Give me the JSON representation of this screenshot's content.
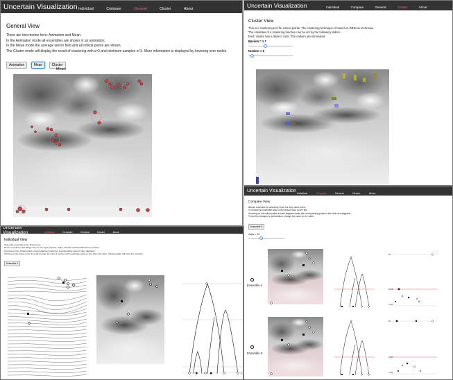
{
  "general": {
    "brand": "Uncertain Visualization",
    "nav": [
      "Individual",
      "Compare",
      "General",
      "Cluster",
      "About"
    ],
    "title": "General View",
    "desc": [
      "There are two modes here: Animation and Mean.",
      "In the Animation mode all ensembles are shown in an animation.",
      "In the Mean mode the average vector field and all critical points are shown.",
      "The Cluster mode will display the result of clustering with ε=3 and minimum samples of 3. More information is displayed by hovering over nodes."
    ],
    "buttons": [
      "Animation",
      "Mean",
      "Cluster"
    ],
    "active_button": "Mean",
    "chart_title": "Mean"
  },
  "cluster": {
    "brand": "Uncertain Visualization",
    "nav": [
      "Individual",
      "Compare",
      "General",
      "Cluster",
      "About"
    ],
    "title": "Cluster View",
    "desc": [
      "This is a clustering tool for critical points. The clustering technique is based on DBScan technique.",
      "The variables of a clustering function can be set by the following sliders.",
      "Each cluster has a distinct color. The outliers are eliminated."
    ],
    "epsilon_label": "Epsilon = 1.7",
    "epsilon_value": 1.7,
    "number_label": "Number = 6",
    "number_value": 6
  },
  "individual": {
    "brand": "Uncertain Visualization",
    "nav": [
      "Individual",
      "Compare",
      "General",
      "Cluster",
      "About"
    ],
    "title": "Individual View",
    "desc": [
      "Select the ensemble to be shown here.",
      "Hover on points in the Merge Tree to see Type, Degree, Value, Simplex and the Robustness of them.",
      "Hovering on the critical points in each diagram marks the corresponding point in other diagrams.",
      "Clicking on the points in the tree will change the color of vectors with magnitude equal or less than this value. Clicking again will clear the selection."
    ],
    "dropdown": "Ensemble 4"
  },
  "compare": {
    "brand": "Uncertain Visualization",
    "nav": [
      "Individual",
      "Compare",
      "General",
      "Cluster",
      "About"
    ],
    "title": "Compare View",
    "desc": [
      "Add an ensemble by selecting it from the drop down menu.",
      "To remove an ensemble click on the remove icon on the left.",
      "Hovering on the critical points in each diagram marks the corresponding points in the other two diagrams.",
      "To see the changes by perturbation, change the value on the slider."
    ],
    "dropdown": "Ensemble 6",
    "value_label": "Value = 13",
    "value": 13,
    "ensembles": [
      {
        "label": "Ensemble 4",
        "tick_top": "60",
        "tick_mid": "0.170",
        "tick_bot": "0.053"
      },
      {
        "label": "Ensemble 5",
        "tick_top": "60",
        "tick_mid": "0.190",
        "tick_bot": "0.053"
      }
    ]
  }
}
